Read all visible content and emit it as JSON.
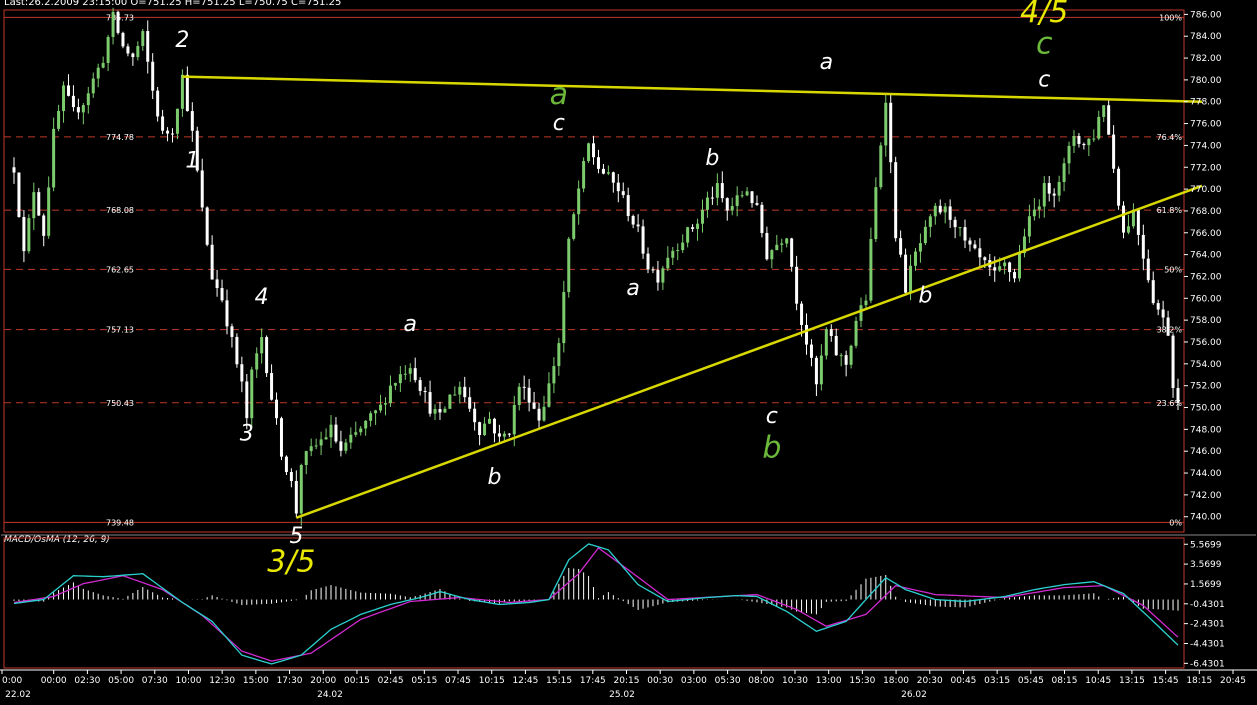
{
  "header": {
    "text": "Last:26.2.2009 23:15:00 O=751.25 H=751.25 L=750.75 C=751.25"
  },
  "macd_title": "MACD/OsMA (12, 26, 9)",
  "colors": {
    "background": "#000000",
    "frame": "#c0392b",
    "fib": "#c0392b",
    "trend": "#d8d800",
    "bull": "#7ccc6e",
    "bear": "#ffffff",
    "label_green": "#6cb83a",
    "label_yellow": "#e8e800",
    "macd": "#2bd1cf",
    "signal": "#d02ad0",
    "hist": "#ffffff"
  },
  "chart_data": [
    {
      "type": "candlestick",
      "title": "",
      "xlabel": "",
      "ylabel": "",
      "ylim": [
        738.6,
        786.4
      ],
      "y_ticks": [
        "786.00",
        "784.00",
        "782.00",
        "780.00",
        "778.00",
        "776.00",
        "774.00",
        "772.00",
        "770.00",
        "768.00",
        "766.00",
        "764.00",
        "762.00",
        "760.00",
        "758.00",
        "756.00",
        "754.00",
        "752.00",
        "750.00",
        "748.00",
        "746.00",
        "744.00",
        "742.00",
        "740.00"
      ],
      "fib_levels": [
        {
          "value": 785.73,
          "label_left": "785.73",
          "label_right": "100%"
        },
        {
          "value": 774.78,
          "label_left": "774.78",
          "label_right": "76.4%"
        },
        {
          "value": 768.08,
          "label_left": "768.08",
          "label_right": "61.8%"
        },
        {
          "value": 762.65,
          "label_left": "762.65",
          "label_right": "50%"
        },
        {
          "value": 757.13,
          "label_left": "757.13",
          "label_right": "38.2%"
        },
        {
          "value": 750.43,
          "label_left": "750.43",
          "label_right": "23.6%"
        },
        {
          "value": 739.48,
          "label_left": "739.48",
          "label_right": "0%"
        }
      ],
      "x_ticks": [
        "0:00",
        "00:00",
        "02:30",
        "05:00",
        "07:30",
        "10:00",
        "12:30",
        "15:00",
        "17:30",
        "20:00",
        "00:15",
        "02:45",
        "05:15",
        "07:45",
        "10:15",
        "12:45",
        "15:15",
        "17:45",
        "20:15",
        "00:30",
        "03:00",
        "05:30",
        "08:00",
        "10:30",
        "13:00",
        "15:30",
        "18:00",
        "20:30",
        "00:45",
        "03:15",
        "05:45",
        "08:15",
        "10:45",
        "13:15",
        "15:45",
        "18:15",
        "20:45"
      ],
      "date_labels": [
        "22.02",
        "24.02",
        "25.02",
        "26.02"
      ],
      "anchors": [
        [
          0,
          772
        ],
        [
          1,
          768
        ],
        [
          2,
          764
        ],
        [
          4,
          770
        ],
        [
          6,
          766
        ],
        [
          8,
          775
        ],
        [
          10,
          779
        ],
        [
          12,
          777
        ],
        [
          14,
          778
        ],
        [
          16,
          780
        ],
        [
          18,
          782
        ],
        [
          20,
          785.7
        ],
        [
          22,
          783
        ],
        [
          24,
          782
        ],
        [
          26,
          784
        ],
        [
          28,
          779
        ],
        [
          30,
          775
        ],
        [
          32,
          775.5
        ],
        [
          34,
          780.3
        ],
        [
          36,
          775
        ],
        [
          38,
          768
        ],
        [
          40,
          762
        ],
        [
          42,
          760
        ],
        [
          44,
          756
        ],
        [
          46,
          752
        ],
        [
          47,
          749
        ],
        [
          48,
          753
        ],
        [
          50,
          756.5
        ],
        [
          52,
          751
        ],
        [
          54,
          746
        ],
        [
          56,
          743
        ],
        [
          57,
          740.5
        ],
        [
          58,
          745
        ],
        [
          60,
          746
        ],
        [
          62,
          747
        ],
        [
          64,
          748
        ],
        [
          66,
          746
        ],
        [
          68,
          747
        ],
        [
          70,
          748
        ],
        [
          72,
          749
        ],
        [
          74,
          750
        ],
        [
          76,
          752
        ],
        [
          78,
          753
        ],
        [
          80,
          754
        ],
        [
          82,
          752
        ],
        [
          84,
          750
        ],
        [
          86,
          749
        ],
        [
          88,
          751
        ],
        [
          90,
          752
        ],
        [
          92,
          750
        ],
        [
          94,
          748
        ],
        [
          96,
          749
        ],
        [
          98,
          747
        ],
        [
          100,
          748
        ],
        [
          102,
          752
        ],
        [
          104,
          751
        ],
        [
          106,
          749
        ],
        [
          108,
          752
        ],
        [
          110,
          756
        ],
        [
          112,
          765
        ],
        [
          114,
          770
        ],
        [
          116,
          774
        ],
        [
          118,
          772
        ],
        [
          120,
          771
        ],
        [
          122,
          770
        ],
        [
          124,
          768
        ],
        [
          126,
          766
        ],
        [
          128,
          763
        ],
        [
          130,
          762
        ],
        [
          132,
          764
        ],
        [
          134,
          765
        ],
        [
          136,
          766
        ],
        [
          138,
          767
        ],
        [
          140,
          769
        ],
        [
          142,
          770
        ],
        [
          144,
          768
        ],
        [
          146,
          769
        ],
        [
          148,
          770
        ],
        [
          150,
          768
        ],
        [
          152,
          764
        ],
        [
          154,
          765
        ],
        [
          156,
          766
        ],
        [
          158,
          760
        ],
        [
          160,
          756
        ],
        [
          162,
          752
        ],
        [
          164,
          757
        ],
        [
          166,
          755
        ],
        [
          168,
          754
        ],
        [
          170,
          758
        ],
        [
          172,
          760
        ],
        [
          174,
          770
        ],
        [
          176,
          778.5
        ],
        [
          178,
          766
        ],
        [
          180,
          761
        ],
        [
          182,
          764
        ],
        [
          184,
          766
        ],
        [
          186,
          768
        ],
        [
          188,
          768
        ],
        [
          190,
          767
        ],
        [
          192,
          765
        ],
        [
          194,
          764
        ],
        [
          196,
          763
        ],
        [
          198,
          762
        ],
        [
          200,
          763
        ],
        [
          202,
          762
        ],
        [
          204,
          766
        ],
        [
          206,
          768
        ],
        [
          208,
          770
        ],
        [
          210,
          770
        ],
        [
          212,
          772
        ],
        [
          214,
          775
        ],
        [
          216,
          774
        ],
        [
          218,
          775
        ],
        [
          220,
          778
        ],
        [
          222,
          772
        ],
        [
          224,
          766
        ],
        [
          226,
          768
        ],
        [
          228,
          764
        ],
        [
          230,
          760
        ],
        [
          232,
          758
        ],
        [
          233,
          757
        ],
        [
          234,
          752
        ],
        [
          235,
          751
        ]
      ],
      "trendlines": [
        {
          "from": [
            34,
            780.3
          ],
          "to": [
            235,
            778.0
          ]
        },
        {
          "from": [
            57,
            739.9
          ],
          "to": [
            235,
            770.3
          ]
        }
      ],
      "wave_labels": [
        {
          "text": "1",
          "x": 36,
          "y": 772.0,
          "color": "white"
        },
        {
          "text": "2",
          "x": 34,
          "y": 783.0,
          "color": "white"
        },
        {
          "text": "3",
          "x": 47,
          "y": 747.0,
          "color": "white"
        },
        {
          "text": "4",
          "x": 50,
          "y": 759.5,
          "color": "white"
        },
        {
          "text": "5",
          "x": 57,
          "y": 737.6,
          "color": "white"
        },
        {
          "text": "3/5",
          "x": 56,
          "y": 735.0,
          "color": "yellow"
        },
        {
          "text": "a",
          "x": 80,
          "y": 757.0,
          "color": "white"
        },
        {
          "text": "b",
          "x": 97,
          "y": 743.0,
          "color": "white"
        },
        {
          "text": "a",
          "x": 110,
          "y": 777.8,
          "color": "green"
        },
        {
          "text": "c",
          "x": 110,
          "y": 775.4,
          "color": "white"
        },
        {
          "text": "a",
          "x": 125,
          "y": 760.3,
          "color": "white"
        },
        {
          "text": "b",
          "x": 141,
          "y": 772.2,
          "color": "white"
        },
        {
          "text": "c",
          "x": 153,
          "y": 748.6,
          "color": "white"
        },
        {
          "text": "b",
          "x": 153,
          "y": 745.4,
          "color": "green"
        },
        {
          "text": "a",
          "x": 164,
          "y": 781.0,
          "color": "white"
        },
        {
          "text": "b",
          "x": 184,
          "y": 759.6,
          "color": "white"
        },
        {
          "text": "4/5",
          "x": 208,
          "y": 785.3,
          "color": "yellow"
        },
        {
          "text": "c",
          "x": 208,
          "y": 782.4,
          "color": "green"
        },
        {
          "text": "c",
          "x": 208,
          "y": 779.4,
          "color": "white"
        }
      ]
    },
    {
      "type": "line",
      "title": "MACD/OsMA (12, 26, 9)",
      "ylim": [
        -6.9,
        6.2
      ],
      "y_ticks": [
        "5.5699",
        "3.5699",
        "1.5699",
        "-0.4301",
        "-2.4301",
        "-4.4301",
        "-6.4301"
      ],
      "macd_anchors": [
        [
          0,
          -0.4
        ],
        [
          6,
          0
        ],
        [
          12,
          2.4
        ],
        [
          18,
          2.3
        ],
        [
          26,
          2.6
        ],
        [
          34,
          -0.3
        ],
        [
          40,
          -2.2
        ],
        [
          46,
          -5.6
        ],
        [
          52,
          -6.5
        ],
        [
          58,
          -5.6
        ],
        [
          64,
          -3
        ],
        [
          70,
          -1.5
        ],
        [
          76,
          -0.5
        ],
        [
          82,
          0.2
        ],
        [
          86,
          0.8
        ],
        [
          92,
          0
        ],
        [
          98,
          -0.5
        ],
        [
          104,
          -0.3
        ],
        [
          108,
          0
        ],
        [
          112,
          4
        ],
        [
          116,
          5.6
        ],
        [
          120,
          5
        ],
        [
          126,
          1.5
        ],
        [
          132,
          -0.2
        ],
        [
          140,
          0.2
        ],
        [
          146,
          0.4
        ],
        [
          150,
          0.3
        ],
        [
          156,
          -1.2
        ],
        [
          162,
          -3.2
        ],
        [
          168,
          -2.2
        ],
        [
          172,
          0
        ],
        [
          176,
          2.2
        ],
        [
          180,
          1
        ],
        [
          186,
          0
        ],
        [
          192,
          -0.2
        ],
        [
          200,
          0.3
        ],
        [
          206,
          1
        ],
        [
          212,
          1.5
        ],
        [
          218,
          1.8
        ],
        [
          224,
          0.6
        ],
        [
          230,
          -2.2
        ],
        [
          235,
          -4.6
        ]
      ],
      "signal_anchors": [
        [
          0,
          -0.3
        ],
        [
          8,
          0.3
        ],
        [
          14,
          1.6
        ],
        [
          22,
          2.4
        ],
        [
          30,
          1
        ],
        [
          38,
          -1.6
        ],
        [
          46,
          -5.2
        ],
        [
          52,
          -6.2
        ],
        [
          60,
          -5.4
        ],
        [
          70,
          -2
        ],
        [
          80,
          -0.2
        ],
        [
          90,
          0.2
        ],
        [
          100,
          -0.3
        ],
        [
          108,
          0
        ],
        [
          114,
          2.6
        ],
        [
          118,
          5.2
        ],
        [
          124,
          3
        ],
        [
          132,
          0
        ],
        [
          150,
          0.5
        ],
        [
          158,
          -1
        ],
        [
          164,
          -2.7
        ],
        [
          172,
          -1.5
        ],
        [
          178,
          1.4
        ],
        [
          186,
          0.5
        ],
        [
          200,
          0.2
        ],
        [
          212,
          1.2
        ],
        [
          220,
          1.4
        ],
        [
          228,
          -0.6
        ],
        [
          235,
          -3.8
        ]
      ]
    }
  ]
}
